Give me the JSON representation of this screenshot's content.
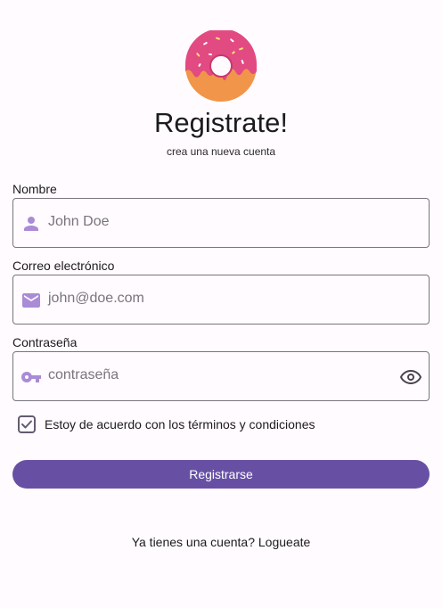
{
  "header": {
    "logo": "donut-logo",
    "title": "Registrate!",
    "subtitle": "crea una nueva cuenta"
  },
  "form": {
    "name": {
      "label": "Nombre",
      "placeholder": "John Doe",
      "icon": "person-icon"
    },
    "email": {
      "label": "Correo electrónico",
      "placeholder": "john@doe.com",
      "icon": "mail-icon"
    },
    "password": {
      "label": "Contraseña",
      "placeholder": "contraseña",
      "icon": "key-icon",
      "toggle_icon": "eye-icon"
    },
    "terms": {
      "label": "Estoy de acuerdo con los términos y condiciones",
      "checked": true
    },
    "submit_label": "Registrarse"
  },
  "footer": {
    "login_prompt": "Ya tienes una cuenta? Logueate"
  },
  "colors": {
    "primary": "#6750a4",
    "icon": "#a98bd6",
    "outline": "#79747e",
    "background": "#fffbfe"
  }
}
